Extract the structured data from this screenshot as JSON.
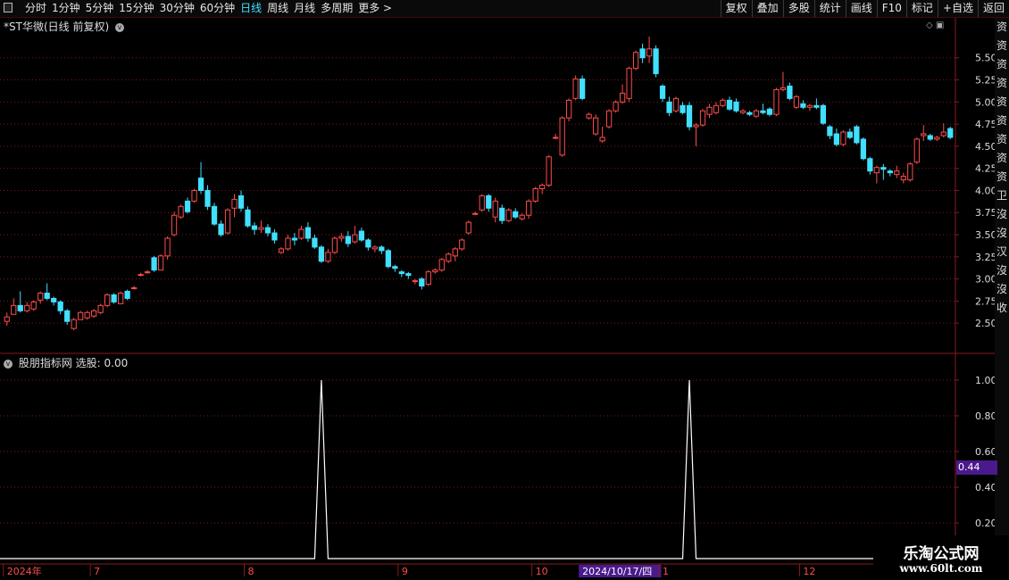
{
  "toolbar": {
    "tabs": [
      "分时",
      "1分钟",
      "5分钟",
      "15分钟",
      "30分钟",
      "60分钟",
      "日线",
      "周线",
      "月线",
      "多周期",
      "更多 >"
    ],
    "active_tab": "日线",
    "right_buttons": [
      "复权",
      "叠加",
      "多股",
      "统计",
      "画线",
      "F10",
      "标记",
      "+自选",
      "返回"
    ]
  },
  "main": {
    "title": "*ST华微(日线 前复权)",
    "circle_glyph": "v"
  },
  "indicator": {
    "title": "股朋指标网 选股: 0.00",
    "highlight_value": "0.44"
  },
  "colors": {
    "up": "#ff4c4c",
    "down": "#40e0ff",
    "grid": "#7a1a1a",
    "axis_text": "#ddd"
  },
  "chart_data": [
    {
      "type": "candlestick",
      "ylim": [
        2.3,
        5.8
      ],
      "yticks": [
        5.5,
        5.25,
        5.0,
        4.75,
        4.5,
        4.25,
        4.0,
        3.75,
        3.5,
        3.25,
        3.0,
        2.75,
        2.5
      ],
      "ohlc": [
        [
          2.52,
          2.62,
          2.47,
          2.57
        ],
        [
          2.6,
          2.78,
          2.6,
          2.7
        ],
        [
          2.7,
          2.86,
          2.62,
          2.64
        ],
        [
          2.64,
          2.74,
          2.62,
          2.7
        ],
        [
          2.66,
          2.76,
          2.64,
          2.74
        ],
        [
          2.76,
          2.86,
          2.72,
          2.84
        ],
        [
          2.84,
          2.95,
          2.76,
          2.78
        ],
        [
          2.78,
          2.8,
          2.7,
          2.74
        ],
        [
          2.74,
          2.76,
          2.6,
          2.64
        ],
        [
          2.64,
          2.66,
          2.48,
          2.52
        ],
        [
          2.44,
          2.56,
          2.42,
          2.54
        ],
        [
          2.54,
          2.64,
          2.54,
          2.62
        ],
        [
          2.56,
          2.64,
          2.54,
          2.62
        ],
        [
          2.58,
          2.66,
          2.56,
          2.64
        ],
        [
          2.62,
          2.72,
          2.6,
          2.7
        ],
        [
          2.7,
          2.84,
          2.68,
          2.82
        ],
        [
          2.82,
          2.84,
          2.72,
          2.74
        ],
        [
          2.72,
          2.86,
          2.72,
          2.84
        ],
        [
          2.86,
          2.88,
          2.76,
          2.78
        ],
        [
          2.9,
          2.92,
          2.88,
          2.9
        ],
        [
          3.05,
          3.07,
          3.03,
          3.05
        ],
        [
          3.08,
          3.1,
          3.06,
          3.08
        ],
        [
          3.24,
          3.26,
          3.08,
          3.1
        ],
        [
          3.1,
          3.28,
          3.1,
          3.26
        ],
        [
          3.26,
          3.48,
          3.22,
          3.46
        ],
        [
          3.5,
          3.76,
          3.48,
          3.72
        ],
        [
          3.7,
          3.84,
          3.68,
          3.82
        ],
        [
          3.88,
          3.92,
          3.74,
          3.76
        ],
        [
          3.88,
          4.02,
          3.86,
          4.0
        ],
        [
          4.14,
          4.32,
          3.96,
          4.0
        ],
        [
          4.0,
          4.06,
          3.78,
          3.82
        ],
        [
          3.82,
          3.86,
          3.6,
          3.62
        ],
        [
          3.62,
          3.66,
          3.48,
          3.5
        ],
        [
          3.52,
          3.8,
          3.5,
          3.78
        ],
        [
          3.8,
          3.96,
          3.7,
          3.9
        ],
        [
          3.94,
          4.0,
          3.76,
          3.8
        ],
        [
          3.78,
          3.82,
          3.58,
          3.6
        ],
        [
          3.6,
          3.64,
          3.5,
          3.56
        ],
        [
          3.56,
          3.66,
          3.52,
          3.58
        ],
        [
          3.58,
          3.62,
          3.48,
          3.52
        ],
        [
          3.52,
          3.56,
          3.4,
          3.44
        ],
        [
          3.3,
          3.36,
          3.28,
          3.34
        ],
        [
          3.34,
          3.5,
          3.32,
          3.46
        ],
        [
          3.46,
          3.52,
          3.38,
          3.44
        ],
        [
          3.46,
          3.6,
          3.44,
          3.56
        ],
        [
          3.58,
          3.64,
          3.42,
          3.46
        ],
        [
          3.46,
          3.5,
          3.34,
          3.36
        ],
        [
          3.36,
          3.38,
          3.18,
          3.2
        ],
        [
          3.2,
          3.34,
          3.18,
          3.3
        ],
        [
          3.3,
          3.48,
          3.28,
          3.46
        ],
        [
          3.46,
          3.52,
          3.42,
          3.48
        ],
        [
          3.48,
          3.54,
          3.36,
          3.4
        ],
        [
          3.42,
          3.6,
          3.4,
          3.5
        ],
        [
          3.54,
          3.58,
          3.42,
          3.44
        ],
        [
          3.44,
          3.46,
          3.32,
          3.36
        ],
        [
          3.34,
          3.38,
          3.3,
          3.36
        ],
        [
          3.36,
          3.38,
          3.28,
          3.32
        ],
        [
          3.32,
          3.34,
          3.12,
          3.14
        ],
        [
          3.14,
          3.16,
          3.08,
          3.12
        ],
        [
          3.08,
          3.1,
          3.02,
          3.06
        ],
        [
          3.06,
          3.08,
          3.0,
          3.04
        ],
        [
          2.98,
          3.0,
          2.94,
          2.98
        ],
        [
          3.0,
          3.02,
          2.88,
          2.92
        ],
        [
          2.94,
          3.1,
          2.92,
          3.08
        ],
        [
          3.08,
          3.12,
          3.06,
          3.1
        ],
        [
          3.1,
          3.24,
          3.08,
          3.22
        ],
        [
          3.2,
          3.3,
          3.18,
          3.28
        ],
        [
          3.26,
          3.36,
          3.2,
          3.34
        ],
        [
          3.34,
          3.46,
          3.32,
          3.44
        ],
        [
          3.52,
          3.66,
          3.5,
          3.64
        ],
        [
          3.74,
          3.76,
          3.72,
          3.74
        ],
        [
          3.78,
          3.96,
          3.76,
          3.94
        ],
        [
          3.94,
          3.96,
          3.76,
          3.8
        ],
        [
          3.7,
          3.92,
          3.64,
          3.88
        ],
        [
          3.8,
          3.84,
          3.62,
          3.66
        ],
        [
          3.66,
          3.8,
          3.64,
          3.78
        ],
        [
          3.76,
          3.8,
          3.68,
          3.7
        ],
        [
          3.68,
          3.74,
          3.66,
          3.72
        ],
        [
          3.72,
          3.9,
          3.68,
          3.88
        ],
        [
          3.88,
          4.04,
          3.86,
          4.02
        ],
        [
          4.02,
          4.08,
          3.96,
          4.06
        ],
        [
          4.06,
          4.4,
          4.04,
          4.38
        ],
        [
          4.6,
          4.64,
          4.58,
          4.6
        ],
        [
          4.4,
          4.84,
          4.38,
          4.82
        ],
        [
          4.82,
          5.04,
          4.78,
          5.02
        ],
        [
          5.04,
          5.3,
          5.02,
          5.26
        ],
        [
          5.26,
          5.3,
          5.02,
          5.04
        ],
        [
          4.82,
          4.88,
          4.8,
          4.86
        ],
        [
          4.64,
          4.86,
          4.62,
          4.82
        ],
        [
          4.56,
          4.72,
          4.54,
          4.6
        ],
        [
          4.72,
          4.92,
          4.7,
          4.9
        ],
        [
          4.9,
          5.02,
          4.88,
          5.0
        ],
        [
          5.0,
          5.2,
          4.98,
          5.1
        ],
        [
          5.04,
          5.4,
          5.0,
          5.38
        ],
        [
          5.38,
          5.58,
          5.36,
          5.56
        ],
        [
          5.6,
          5.66,
          5.44,
          5.5
        ],
        [
          5.52,
          5.74,
          5.44,
          5.6
        ],
        [
          5.6,
          5.64,
          5.28,
          5.32
        ],
        [
          5.18,
          5.2,
          5.0,
          5.04
        ],
        [
          5.0,
          5.06,
          4.84,
          4.88
        ],
        [
          4.9,
          5.06,
          4.88,
          5.04
        ],
        [
          4.96,
          5.0,
          4.86,
          4.88
        ],
        [
          4.96,
          5.0,
          4.68,
          4.72
        ],
        [
          4.72,
          4.76,
          4.5,
          4.74
        ],
        [
          4.74,
          4.92,
          4.72,
          4.9
        ],
        [
          4.86,
          4.98,
          4.82,
          4.94
        ],
        [
          4.88,
          5.0,
          4.86,
          4.96
        ],
        [
          4.96,
          5.04,
          4.94,
          5.02
        ],
        [
          5.02,
          5.06,
          4.9,
          4.92
        ],
        [
          5.0,
          5.04,
          4.88,
          4.9
        ],
        [
          4.88,
          4.92,
          4.86,
          4.9
        ],
        [
          4.88,
          4.9,
          4.84,
          4.86
        ],
        [
          4.84,
          4.92,
          4.82,
          4.9
        ],
        [
          4.9,
          4.98,
          4.86,
          4.88
        ],
        [
          4.92,
          4.94,
          4.84,
          4.86
        ],
        [
          4.86,
          5.16,
          4.84,
          5.14
        ],
        [
          5.14,
          5.34,
          5.12,
          5.16
        ],
        [
          5.18,
          5.22,
          5.02,
          5.04
        ],
        [
          4.94,
          5.08,
          4.92,
          5.06
        ],
        [
          4.98,
          5.02,
          4.92,
          4.94
        ],
        [
          4.94,
          4.98,
          4.9,
          4.96
        ],
        [
          4.96,
          5.04,
          4.92,
          4.94
        ],
        [
          4.96,
          4.98,
          4.74,
          4.76
        ],
        [
          4.72,
          4.74,
          4.58,
          4.62
        ],
        [
          4.64,
          4.7,
          4.5,
          4.52
        ],
        [
          4.52,
          4.68,
          4.5,
          4.66
        ],
        [
          4.66,
          4.7,
          4.58,
          4.6
        ],
        [
          4.72,
          4.74,
          4.52,
          4.54
        ],
        [
          4.58,
          4.6,
          4.34,
          4.36
        ],
        [
          4.36,
          4.38,
          4.18,
          4.22
        ],
        [
          4.2,
          4.28,
          4.08,
          4.26
        ],
        [
          4.26,
          4.3,
          4.12,
          4.24
        ],
        [
          4.22,
          4.24,
          4.16,
          4.2
        ],
        [
          4.18,
          4.28,
          4.14,
          4.22
        ],
        [
          4.12,
          4.2,
          4.08,
          4.16
        ],
        [
          4.12,
          4.32,
          4.1,
          4.3
        ],
        [
          4.32,
          4.6,
          4.3,
          4.58
        ],
        [
          4.62,
          4.74,
          4.56,
          4.64
        ],
        [
          4.62,
          4.64,
          4.56,
          4.58
        ],
        [
          4.58,
          4.62,
          4.56,
          4.6
        ],
        [
          4.62,
          4.76,
          4.6,
          4.66
        ],
        [
          4.7,
          4.72,
          4.58,
          4.6
        ]
      ]
    },
    {
      "type": "line",
      "title": "股朋指标网 选股: 0.00",
      "ylim": [
        0,
        1.05
      ],
      "yticks": [
        1.0,
        0.8,
        0.6,
        0.4,
        0.2
      ],
      "spikes": [
        {
          "date_label_region": "8月下旬",
          "candle_index": 47,
          "value": 1.0
        },
        {
          "date_label_region": "11月",
          "candle_index": 102,
          "value": 1.0
        }
      ],
      "x_labels": [
        {
          "label": "2024年",
          "candle_index": 0,
          "highlight": false
        },
        {
          "label": "7",
          "candle_index": 13,
          "highlight": false
        },
        {
          "label": "8",
          "candle_index": 36,
          "highlight": false
        },
        {
          "label": "9",
          "candle_index": 59,
          "highlight": false
        },
        {
          "label": "10",
          "candle_index": 79,
          "highlight": false
        },
        {
          "label": "2024/10/17/四",
          "candle_index": 86,
          "highlight": true
        },
        {
          "label": "1",
          "candle_index": 98,
          "highlight": false
        },
        {
          "label": "12",
          "candle_index": 119,
          "highlight": false
        },
        {
          "label": "1",
          "candle_index": 141,
          "highlight": false
        }
      ]
    }
  ],
  "watermark": {
    "line1": "乐淘公式网",
    "line2": "www.60lt.com"
  },
  "right_strip_text": "资资资资资资资资资卫沒沒汉沒沒收"
}
